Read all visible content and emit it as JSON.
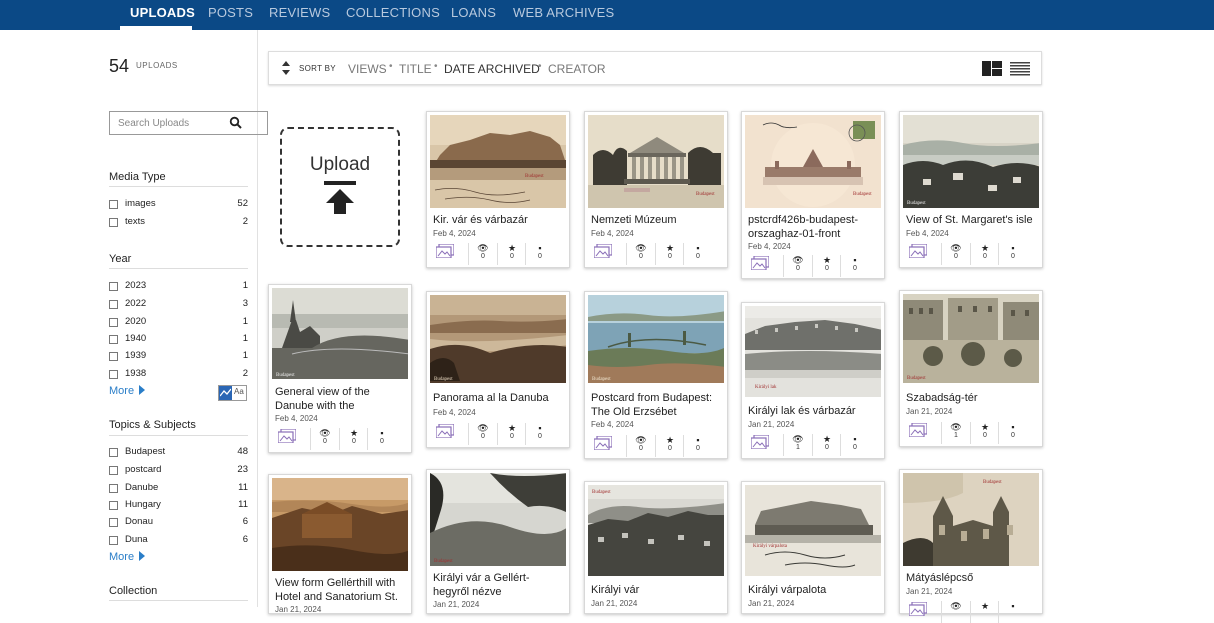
{
  "nav": {
    "tabs": [
      {
        "label": "UPLOADS"
      },
      {
        "label": "POSTS"
      },
      {
        "label": "REVIEWS"
      },
      {
        "label": "COLLECTIONS"
      },
      {
        "label": "LOANS"
      },
      {
        "label": "WEB ARCHIVES"
      }
    ],
    "active": "UPLOADS"
  },
  "sidebar": {
    "count": "54",
    "count_label": "UPLOADS",
    "search_placeholder": "Search Uploads",
    "media_type": {
      "title": "Media Type",
      "items": [
        {
          "label": "images",
          "count": "52"
        },
        {
          "label": "texts",
          "count": "2"
        }
      ]
    },
    "year": {
      "title": "Year",
      "items": [
        {
          "label": "2023",
          "count": "1"
        },
        {
          "label": "2022",
          "count": "3"
        },
        {
          "label": "2020",
          "count": "1"
        },
        {
          "label": "1940",
          "count": "1"
        },
        {
          "label": "1939",
          "count": "1"
        },
        {
          "label": "1938",
          "count": "2"
        }
      ],
      "more": "More"
    },
    "topics": {
      "title": "Topics & Subjects",
      "toggle_text": "Aa",
      "items": [
        {
          "label": "Budapest",
          "count": "48"
        },
        {
          "label": "postcard",
          "count": "23"
        },
        {
          "label": "Danube",
          "count": "11"
        },
        {
          "label": "Hungary",
          "count": "11"
        },
        {
          "label": "Donau",
          "count": "6"
        },
        {
          "label": "Duna",
          "count": "6"
        }
      ],
      "more": "More"
    },
    "collection": {
      "title": "Collection"
    }
  },
  "sortbar": {
    "sort_by": "SORT BY",
    "options": [
      "VIEWS",
      "TITLE",
      "DATE ARCHIVED",
      "CREATOR"
    ],
    "selected": "DATE ARCHIVED"
  },
  "upload_box": {
    "label": "Upload"
  },
  "cards": [
    {
      "title": "Kir. vár és várbazár",
      "date": "Feb 4, 2024",
      "views": "0",
      "favs": "0",
      "reviews": "0"
    },
    {
      "title": "Nemzeti Múzeum",
      "date": "Feb 4, 2024",
      "views": "0",
      "favs": "0",
      "reviews": "0"
    },
    {
      "title": "pstcrdf426b-budapest-orszaghaz-01-front",
      "date": "Feb 4, 2024",
      "views": "0",
      "favs": "0",
      "reviews": "0"
    },
    {
      "title": "View of St. Margaret's isle",
      "date": "Feb 4, 2024",
      "views": "0",
      "favs": "0",
      "reviews": "0"
    },
    {
      "title": "General view of the Danube with the",
      "date": "Feb 4, 2024",
      "views": "0",
      "favs": "0",
      "reviews": "0"
    },
    {
      "title": "Panorama al la Danuba",
      "date": "Feb 4, 2024",
      "views": "0",
      "favs": "0",
      "reviews": "0"
    },
    {
      "title": "Postcard from Budapest: The Old Erzsébet",
      "date": "Feb 4, 2024",
      "views": "0",
      "favs": "0",
      "reviews": "0"
    },
    {
      "title": "Királyi lak és várbazár",
      "date": "Jan 21, 2024",
      "views": "1",
      "favs": "0",
      "reviews": "0"
    },
    {
      "title": "Szabadság-tér",
      "date": "Jan 21, 2024",
      "views": "1",
      "favs": "0",
      "reviews": "0"
    },
    {
      "title": "View form Gellérthill with Hotel and Sanatorium St.",
      "date": "Jan 21, 2024"
    },
    {
      "title": "Királyi vár a Gellért-hegyről nézve",
      "date": "Jan 21, 2024"
    },
    {
      "title": "Királyi vár",
      "date": "Jan 21, 2024"
    },
    {
      "title": "Királyi várpalota",
      "date": "Jan 21, 2024"
    },
    {
      "title": "Mátyáslépcső",
      "date": "Jan 21, 2024"
    }
  ],
  "colors": {
    "nav_bg": "#0b4986",
    "link": "#2a7ec8",
    "media_icon": "#8a6fb8"
  }
}
